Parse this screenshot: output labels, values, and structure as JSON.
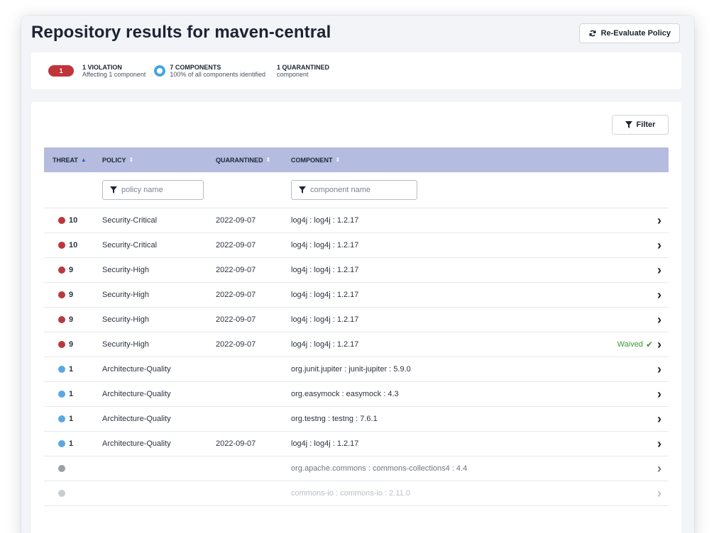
{
  "page": {
    "title": "Repository results for maven-central",
    "reevaluate_label": "Re-Evaluate Policy"
  },
  "summary": {
    "violation_count": "1",
    "violation_title": "1 VIOLATION",
    "violation_sub": "Affecting 1 component",
    "components_title": "7 COMPONENTS",
    "components_sub": "100% of all components identified",
    "quarantined_title": "1 QUARANTINED",
    "quarantined_sub": "component"
  },
  "toolbar": {
    "filter_label": "Filter"
  },
  "table": {
    "headers": {
      "threat": "THREAT",
      "policy": "POLICY",
      "quarantined": "QUARANTINED",
      "component": "COMPONENT"
    },
    "filters": {
      "policy_placeholder": "policy name",
      "component_placeholder": "component name"
    },
    "rows": [
      {
        "threat": "10",
        "color": "#c0343b",
        "policy": "Security-Critical",
        "quarantined": "2022-09-07",
        "component": "log4j : log4j : 1.2.17",
        "waived": ""
      },
      {
        "threat": "10",
        "color": "#c0343b",
        "policy": "Security-Critical",
        "quarantined": "2022-09-07",
        "component": "log4j : log4j : 1.2.17",
        "waived": ""
      },
      {
        "threat": "9",
        "color": "#b83a3f",
        "policy": "Security-High",
        "quarantined": "2022-09-07",
        "component": "log4j : log4j : 1.2.17",
        "waived": ""
      },
      {
        "threat": "9",
        "color": "#b83a3f",
        "policy": "Security-High",
        "quarantined": "2022-09-07",
        "component": "log4j : log4j : 1.2.17",
        "waived": ""
      },
      {
        "threat": "9",
        "color": "#b83a3f",
        "policy": "Security-High",
        "quarantined": "2022-09-07",
        "component": "log4j : log4j : 1.2.17",
        "waived": ""
      },
      {
        "threat": "9",
        "color": "#b83a3f",
        "policy": "Security-High",
        "quarantined": "2022-09-07",
        "component": "log4j : log4j : 1.2.17",
        "waived": "Waived"
      },
      {
        "threat": "1",
        "color": "#5aa7e3",
        "policy": "Architecture-Quality",
        "quarantined": "",
        "component": "org.junit.jupiter : junit-jupiter : 5.9.0",
        "waived": ""
      },
      {
        "threat": "1",
        "color": "#5aa7e3",
        "policy": "Architecture-Quality",
        "quarantined": "",
        "component": "org.easymock : easymock : 4.3",
        "waived": ""
      },
      {
        "threat": "1",
        "color": "#5aa7e3",
        "policy": "Architecture-Quality",
        "quarantined": "",
        "component": "org.testng : testng : 7.6.1",
        "waived": ""
      },
      {
        "threat": "1",
        "color": "#5aa7e3",
        "policy": "Architecture-Quality",
        "quarantined": "2022-09-07",
        "component": "log4j : log4j : 1.2.17",
        "waived": ""
      },
      {
        "threat": "",
        "color": "#9aa0a8",
        "policy": "",
        "quarantined": "",
        "component": "org.apache.commons : commons-collections4 : 4.4",
        "waived": ""
      },
      {
        "threat": "",
        "color": "#c8ccd3",
        "policy": "",
        "quarantined": "",
        "component": "commons-io : commons-io : 2.11.0",
        "waived": ""
      }
    ]
  },
  "icons": {
    "refresh": "refresh-icon",
    "funnel": "funnel-icon",
    "chevron": "chevron-right-icon",
    "check": "check-icon"
  }
}
